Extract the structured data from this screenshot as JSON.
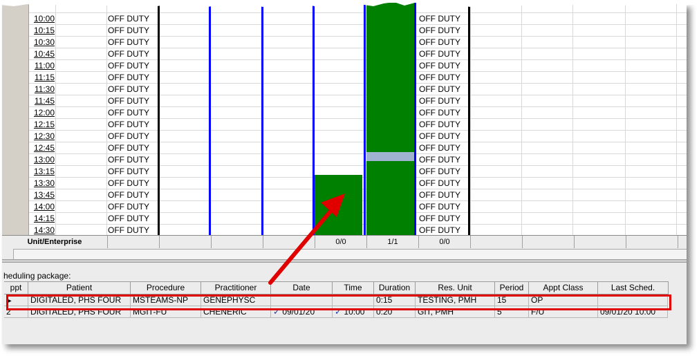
{
  "schedule": {
    "times": [
      "10:00",
      "10:15",
      "10:30",
      "10:45",
      "11:00",
      "11:15",
      "11:30",
      "11:45",
      "12:00",
      "12:15",
      "12:30",
      "12:45",
      "13:00",
      "13:15",
      "13:30",
      "13:45",
      "14:00",
      "14:15",
      "14:30"
    ],
    "status_text": "OFF DUTY"
  },
  "unit_row": {
    "label": "Unit/Enterprise",
    "counts": [
      "0/0",
      "1/1",
      "0/0"
    ]
  },
  "package": {
    "label": "heduling package:",
    "columns": [
      "ppt",
      "Patient",
      "Procedure",
      "Practitioner",
      "Date",
      "Time",
      "Duration",
      "Res. Unit",
      "Period",
      "Appt Class",
      "Last Sched."
    ],
    "rows": [
      {
        "num": "",
        "patient": "DIGITALED, PHS FOUR",
        "procedure": "MSTEAMS-NP",
        "practitioner": "GENEPHYSC",
        "date": "",
        "time": "",
        "duration": "0:15",
        "res_unit": "TESTING, PMH",
        "period": "15",
        "appt_class": "OP",
        "last_sched": "",
        "selected": true
      },
      {
        "num": "2",
        "patient": "DIGITALED, PHS FOUR",
        "procedure": "MGIT-FU",
        "practitioner": "CHENERIC",
        "date": "09/01/20",
        "time": "10:00",
        "duration": "0:20",
        "res_unit": "GIT, PMH",
        "period": "5",
        "appt_class": "F/U",
        "last_sched": "09/01/20 10:00",
        "selected": false
      }
    ]
  },
  "colors": {
    "appointment": "#008000",
    "column_separator": "#0000ff",
    "highlight_box": "#e00000",
    "arrow": "#e00000"
  }
}
